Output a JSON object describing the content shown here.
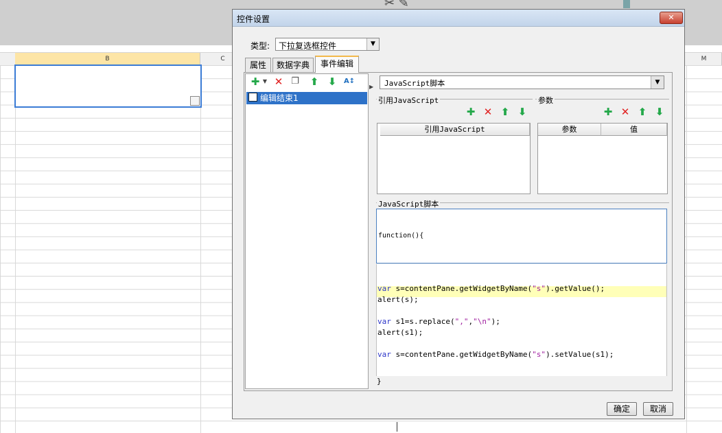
{
  "spreadsheet": {
    "columns": [
      "B",
      "C",
      "M"
    ]
  },
  "dialog": {
    "title": "控件设置",
    "close_label": "✕",
    "type_label": "类型:",
    "type_value": "下拉复选框控件",
    "tabs": [
      {
        "label": "属性",
        "active": false
      },
      {
        "label": "数据字典",
        "active": false
      },
      {
        "label": "事件编辑",
        "active": true
      }
    ],
    "events": {
      "items": [
        {
          "label": "编辑结束1",
          "selected": true
        }
      ]
    },
    "script_type": "JavaScript脚本",
    "ref_group": {
      "label": "引用JavaScript",
      "column": "引用JavaScript"
    },
    "param_group": {
      "label": "参数",
      "columns": [
        "参数",
        "值"
      ]
    },
    "js_group": {
      "label": "JavaScript脚本",
      "function_header": "function(){",
      "closing_brace": "}",
      "code_lines": [
        "var s=contentPane.getWidgetByName(\"s\").getValue();",
        "alert(s);",
        "",
        "var s1=s.replace(\",\",\"\\n\");",
        "alert(s1);",
        "",
        "var s=contentPane.getWidgetByName(\"s\").setValue(s1);"
      ]
    },
    "buttons": {
      "ok": "确定",
      "cancel": "取消"
    }
  },
  "colors": {
    "accent": "#2e72c8",
    "add_green": "#24a84a",
    "delete_red": "#e02020",
    "highlight_line": "#ffffb8"
  }
}
